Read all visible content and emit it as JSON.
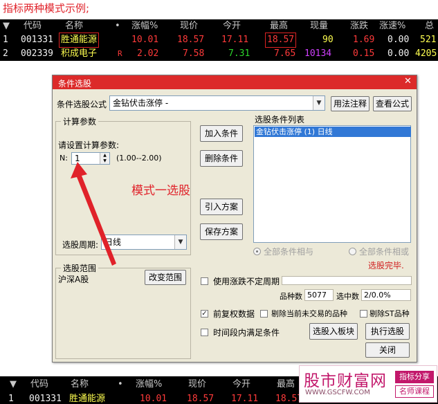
{
  "caption": "指标两种模式示例;",
  "grid_top": {
    "headers": [
      "▼",
      "代码",
      "名称",
      "•",
      "涨幅%",
      "现价",
      "今开",
      "最高",
      "现量",
      "涨跌",
      "涨速%",
      "总"
    ],
    "rows": [
      {
        "idx": "1",
        "code": "001331",
        "name": "胜通能源",
        "flag": "",
        "chg_pct": "10.01",
        "price": "18.57",
        "open": "17.11",
        "high": "18.57",
        "vol": "90",
        "chg": "1.69",
        "speed": "0.00",
        "total": "521"
      },
      {
        "idx": "2",
        "code": "002339",
        "name": "积成电子",
        "flag": "R",
        "chg_pct": "2.02",
        "price": "7.58",
        "open": "7.31",
        "high": "7.65",
        "vol": "10134",
        "chg": "0.15",
        "speed": "0.00",
        "total": "4205"
      }
    ]
  },
  "grid_bottom": {
    "headers": [
      "▼",
      "代码",
      "名称",
      "•",
      "涨幅%",
      "现价",
      "今开",
      "最高"
    ],
    "rows": [
      {
        "idx": "1",
        "code": "001331",
        "name": "胜通能源",
        "chg_pct": "10.01",
        "price": "18.57",
        "open": "17.11",
        "high": "18.57"
      }
    ]
  },
  "dialog": {
    "title": "条件选股",
    "close_glyph": "✕",
    "formula_label": "条件选股公式",
    "formula_value": "金钻伏击涨停 -",
    "usage_btn": "用法注释",
    "view_btn": "查看公式",
    "calc_group_title": "计算参数",
    "calc_prompt": "请设置计算参数:",
    "param_name": "N:",
    "param_value": "1",
    "param_range": "(1.00--2.00)",
    "add_btn": "加入条件",
    "delete_btn": "删除条件",
    "import_btn": "引入方案",
    "save_btn": "保存方案",
    "list_title": "选股条件列表",
    "list_items": [
      "金钻伏击涨停 (1) 日线"
    ],
    "period_label": "选股周期:",
    "period_value": "日线",
    "radio_and": "全部条件相与",
    "radio_or": "全部条件相或",
    "status_done": "选股完毕.",
    "range_group_title": "选股范围",
    "range_value": "沪深A股",
    "change_range_btn": "改变范围",
    "use_period_label": "使用涨跌不定周期",
    "count_label": "品种数",
    "count_value": "5077",
    "selected_label": "选中数",
    "selected_value": "2/0.0%",
    "prev_rights_label": "前复权数据",
    "exclude_untraded_label": "剔除当前未交易的品种",
    "exclude_st_label": "剔除ST品种",
    "time_range_label": "时间段内满足条件",
    "to_block_btn": "选股入板块",
    "execute_btn": "执行选股",
    "close_btn": "关闭",
    "checked_glyph": "✓",
    "spin_up": "▲",
    "spin_down": "▼",
    "dd_glyph": "▼"
  },
  "annotation": "模式一选股",
  "watermark": {
    "main": "股市财富网",
    "url": "WWW.GSCFW.COM",
    "tag1": "指标分享",
    "tag2": "名师课程"
  },
  "colors": {
    "accent_red": "#e0222a",
    "dialog_bg": "#ece9d8",
    "title_bar": "#dc2a2a",
    "grid_bg": "#000000",
    "list_selection": "#3178d6",
    "watermark": "#c2186b"
  },
  "icons": {
    "arrow": "red-arrow-annotation",
    "close": "close-icon",
    "dropdown": "chevron-down-icon"
  }
}
